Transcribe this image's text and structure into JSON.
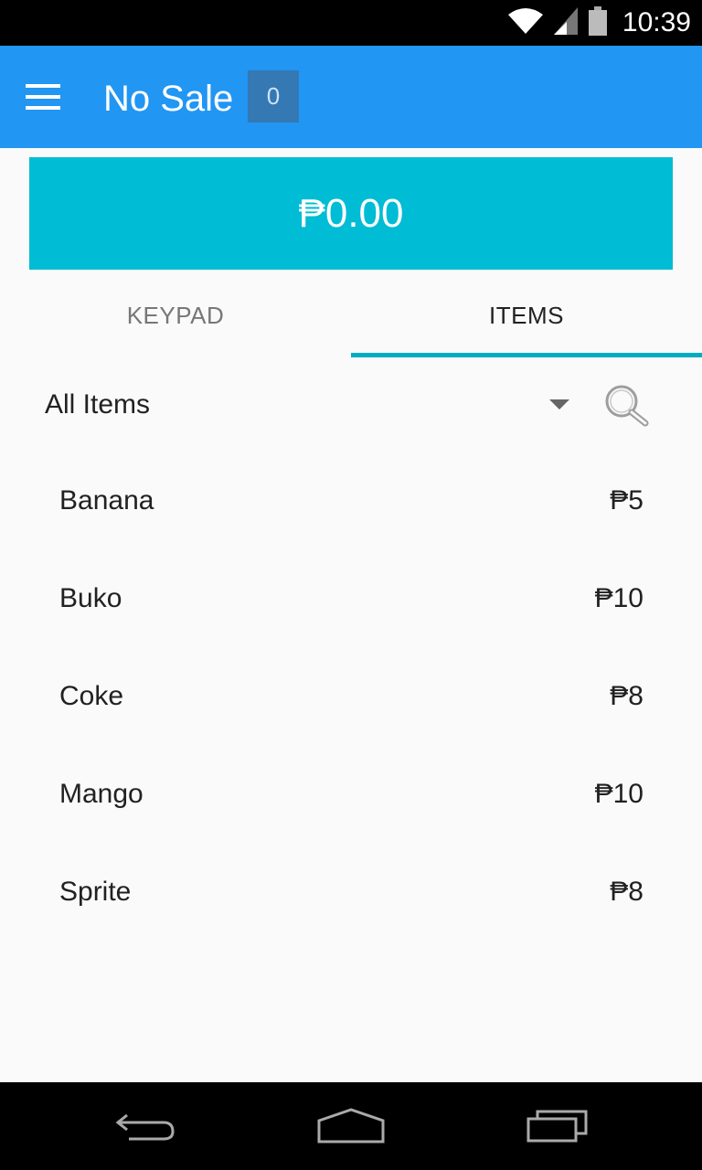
{
  "status_bar": {
    "time": "10:39",
    "icons": [
      "wifi-icon",
      "cell-signal-icon",
      "battery-icon"
    ]
  },
  "app_bar": {
    "title": "No Sale",
    "count": "0",
    "menu_icon": "hamburger-menu-icon",
    "background": "#2196f3"
  },
  "total": {
    "amount": "₱0.00",
    "background": "#00bcd4"
  },
  "tabs": [
    {
      "label": "KEYPAD",
      "selected": false
    },
    {
      "label": "ITEMS",
      "selected": true
    }
  ],
  "filter": {
    "category": "All Items",
    "dropdown_icon": "dropdown-arrow-icon",
    "search_icon": "search-icon"
  },
  "items": [
    {
      "name": "Banana",
      "price": "₱5"
    },
    {
      "name": "Buko",
      "price": "₱10"
    },
    {
      "name": "Coke",
      "price": "₱8"
    },
    {
      "name": "Mango",
      "price": "₱10"
    },
    {
      "name": "Sprite",
      "price": "₱8"
    }
  ],
  "nav_bar": {
    "icons": [
      "back-icon",
      "home-icon",
      "recent-apps-icon"
    ]
  }
}
